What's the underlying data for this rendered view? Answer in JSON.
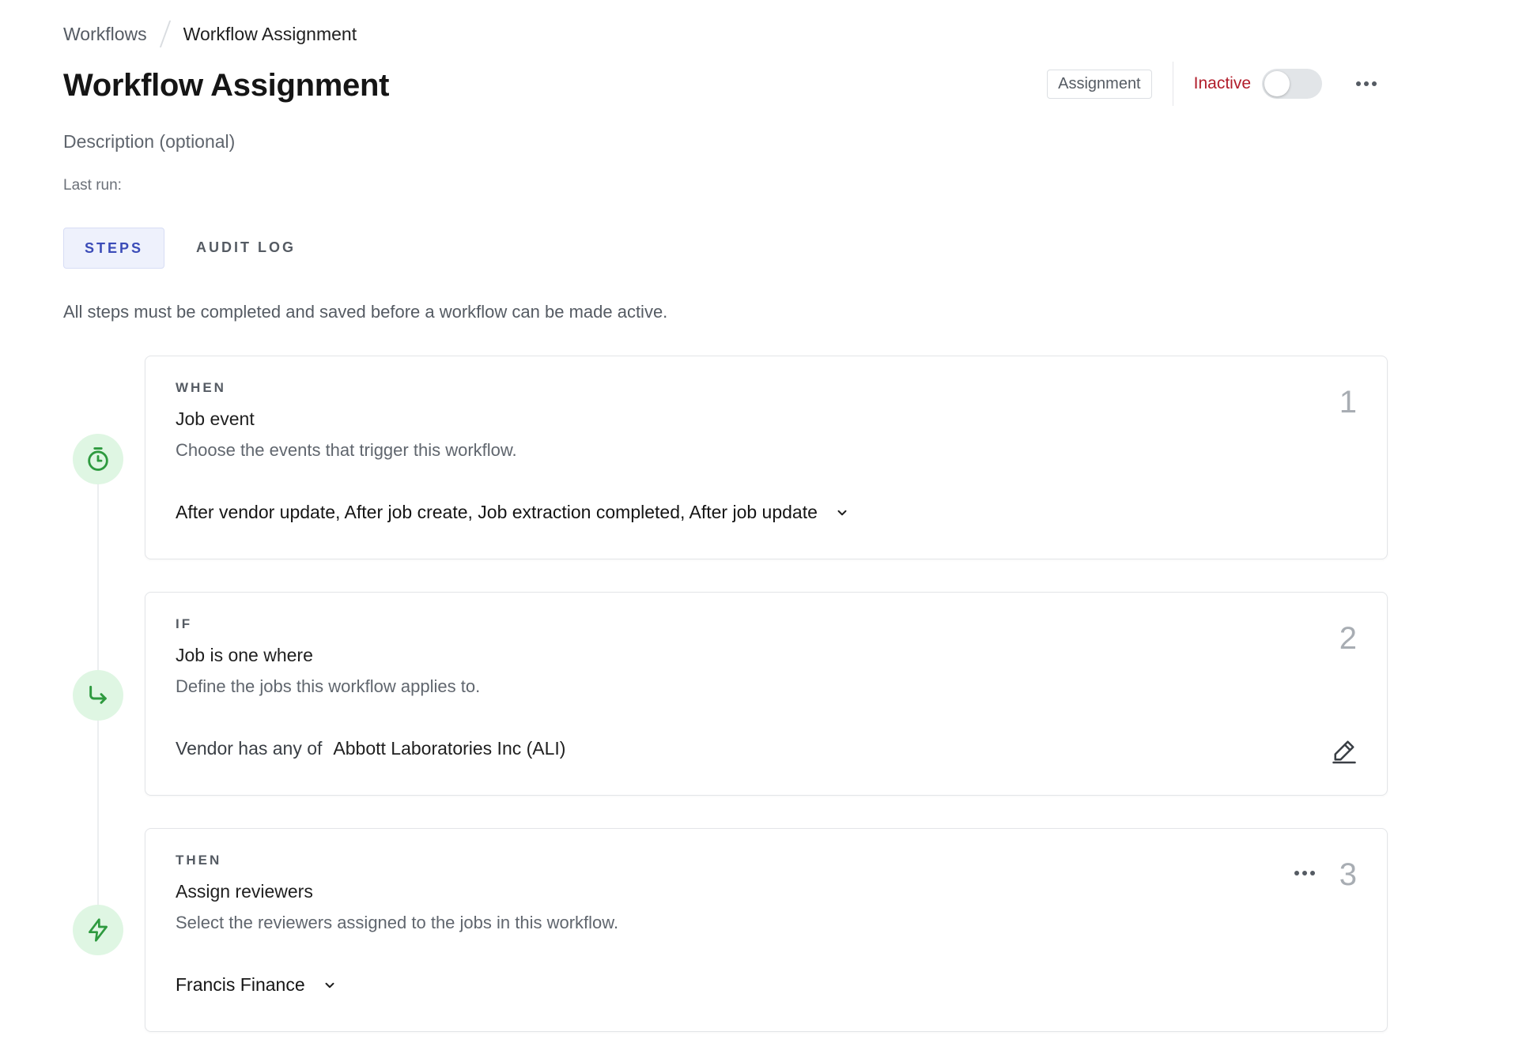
{
  "breadcrumb": {
    "parent": "Workflows",
    "current": "Workflow Assignment"
  },
  "page": {
    "title": "Workflow Assignment",
    "description_placeholder": "Description (optional)",
    "last_run_label": "Last run:"
  },
  "header": {
    "type_badge": "Assignment",
    "status_label": "Inactive",
    "active": false,
    "status_color": "#b11c2a"
  },
  "tabs": [
    {
      "label": "STEPS",
      "active": true
    },
    {
      "label": "AUDIT LOG",
      "active": false
    }
  ],
  "notice": "All steps must be completed and saved before a workflow can be made active.",
  "steps": [
    {
      "kicker": "WHEN",
      "title": "Job event",
      "subtitle": "Choose the events that trigger this workflow.",
      "number": "1",
      "icon": "stopwatch-icon",
      "value": "After vendor update, After job create, Job extraction completed, After job update"
    },
    {
      "kicker": "IF",
      "title": "Job is one where",
      "subtitle": "Define the jobs this workflow applies to.",
      "number": "2",
      "icon": "arrow-turn-right-icon",
      "condition_label": "Vendor has any of",
      "condition_value": "Abbott Laboratories Inc (ALI)"
    },
    {
      "kicker": "THEN",
      "title": "Assign reviewers",
      "subtitle": "Select the reviewers assigned to the jobs in this workflow.",
      "number": "3",
      "icon": "lightning-icon",
      "value": "Francis Finance"
    }
  ],
  "colors": {
    "accent": "#3b4cb8",
    "icon_green": "#2e9a3f",
    "icon_bg": "#dff6e3"
  }
}
